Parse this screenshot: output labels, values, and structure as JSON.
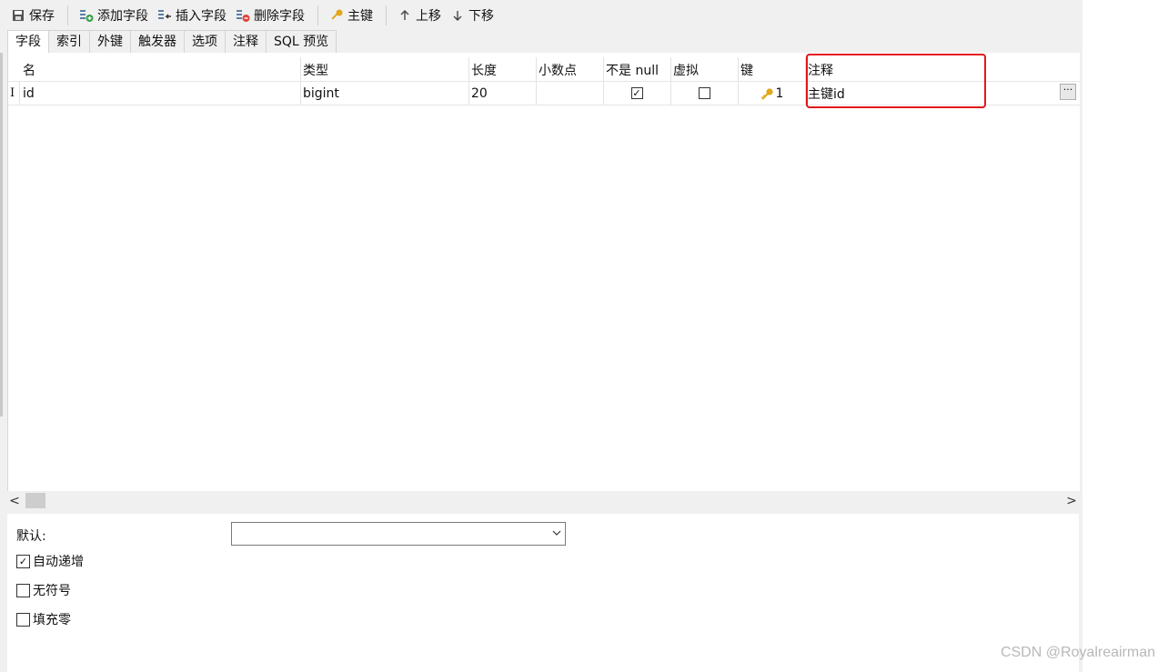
{
  "toolbar": {
    "save": "保存",
    "add_field": "添加字段",
    "insert_field": "插入字段",
    "delete_field": "删除字段",
    "primary_key": "主键",
    "move_up": "上移",
    "move_down": "下移"
  },
  "tabs": [
    "字段",
    "索引",
    "外键",
    "触发器",
    "选项",
    "注释",
    "SQL 预览"
  ],
  "columns": {
    "name": "名",
    "type": "类型",
    "length": "长度",
    "decimals": "小数点",
    "not_null": "不是 null",
    "virtual": "虚拟",
    "key": "键",
    "comment": "注释"
  },
  "rows": [
    {
      "indicator": "I",
      "name": "id",
      "type": "bigint",
      "length": "20",
      "decimals": "",
      "not_null": true,
      "virtual": false,
      "key": "1",
      "comment": "主键id",
      "more_button": "···"
    }
  ],
  "properties": {
    "default_label": "默认:",
    "default_value": "",
    "auto_increment": {
      "label": "自动递增",
      "checked": true
    },
    "unsigned": {
      "label": "无符号",
      "checked": false
    },
    "zerofill": {
      "label": "填充零",
      "checked": false
    }
  },
  "watermark": "CSDN @Royalreairman",
  "colors": {
    "highlight": "#e4161b",
    "key_icon": "#e2a618"
  }
}
